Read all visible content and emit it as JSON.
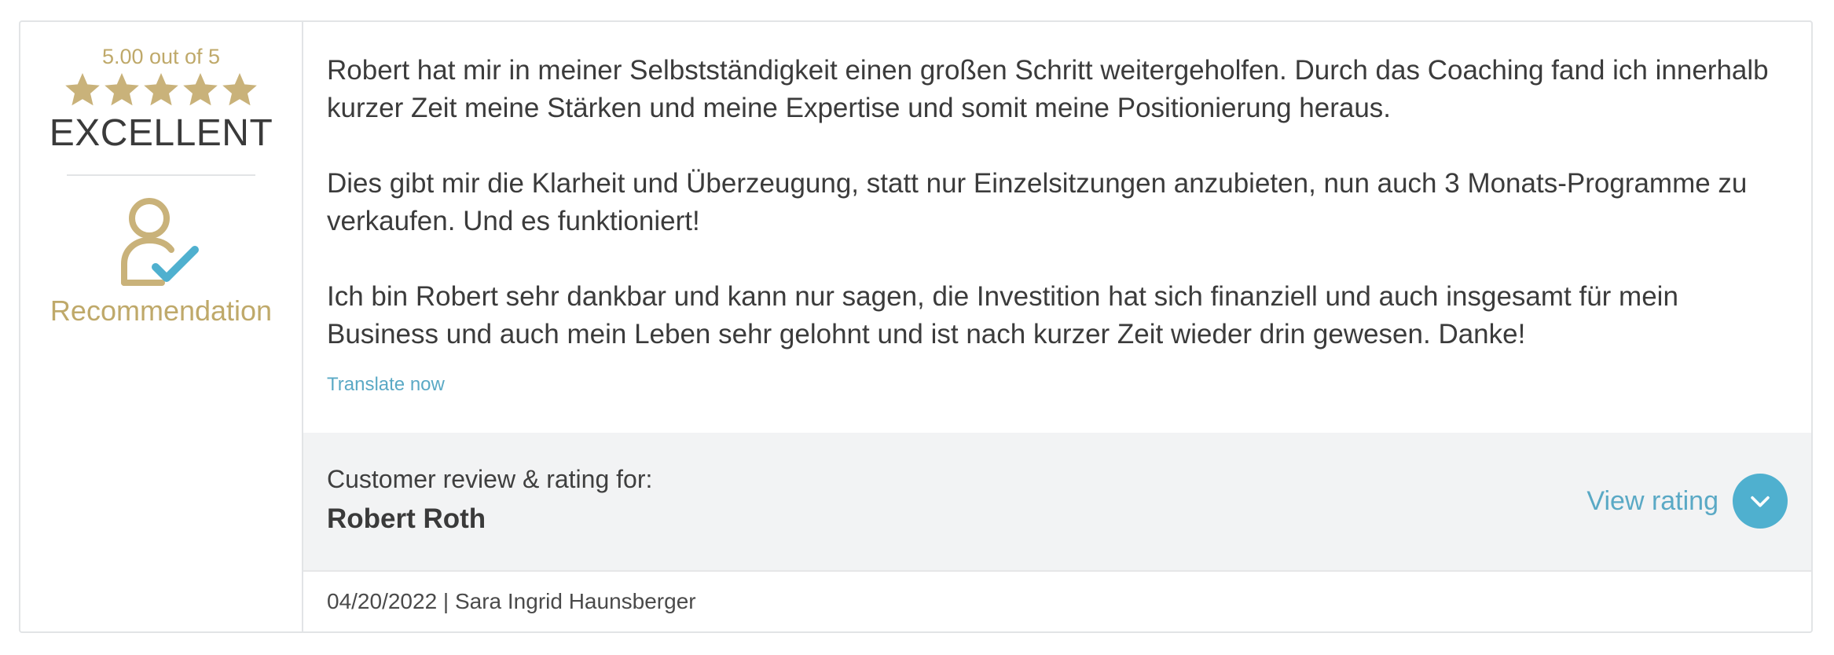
{
  "rating": {
    "score_text": "5.00 out of 5",
    "stars_filled": 5,
    "stars_total": 5,
    "grade": "EXCELLENT",
    "recommendation_label": "Recommendation",
    "star_color": "#c9b27a",
    "accent_color": "#bfa96a",
    "check_color": "#4fb0cf",
    "icons": [
      "star-icon",
      "person-check-icon"
    ]
  },
  "review": {
    "paragraphs": [
      "Robert hat mir in meiner Selbstständigkeit einen großen Schritt weitergeholfen. Durch das Coaching fand ich innerhalb kurzer Zeit meine Stärken und meine Expertise und somit meine Positionierung heraus.",
      "Dies gibt mir die Klarheit und Überzeugung, statt nur Einzelsitzungen anzubieten, nun auch 3 Monats-Programme zu verkaufen. Und es funktioniert!",
      "Ich bin Robert sehr dankbar und kann nur sagen, die Investition hat sich finanziell und auch insgesamt für mein Business und auch mein Leben sehr gelohnt und ist nach kurzer Zeit wieder drin gewesen. Danke!"
    ],
    "translate_link": "Translate now"
  },
  "footer": {
    "for_text": "Customer review & rating for:",
    "name": "Robert Roth",
    "view_rating_label": "View rating",
    "view_rating_icon": "chevron-down-icon",
    "link_color": "#5aa9c5"
  },
  "meta": {
    "line": "04/20/2022 | Sara Ingrid Haunsberger"
  }
}
